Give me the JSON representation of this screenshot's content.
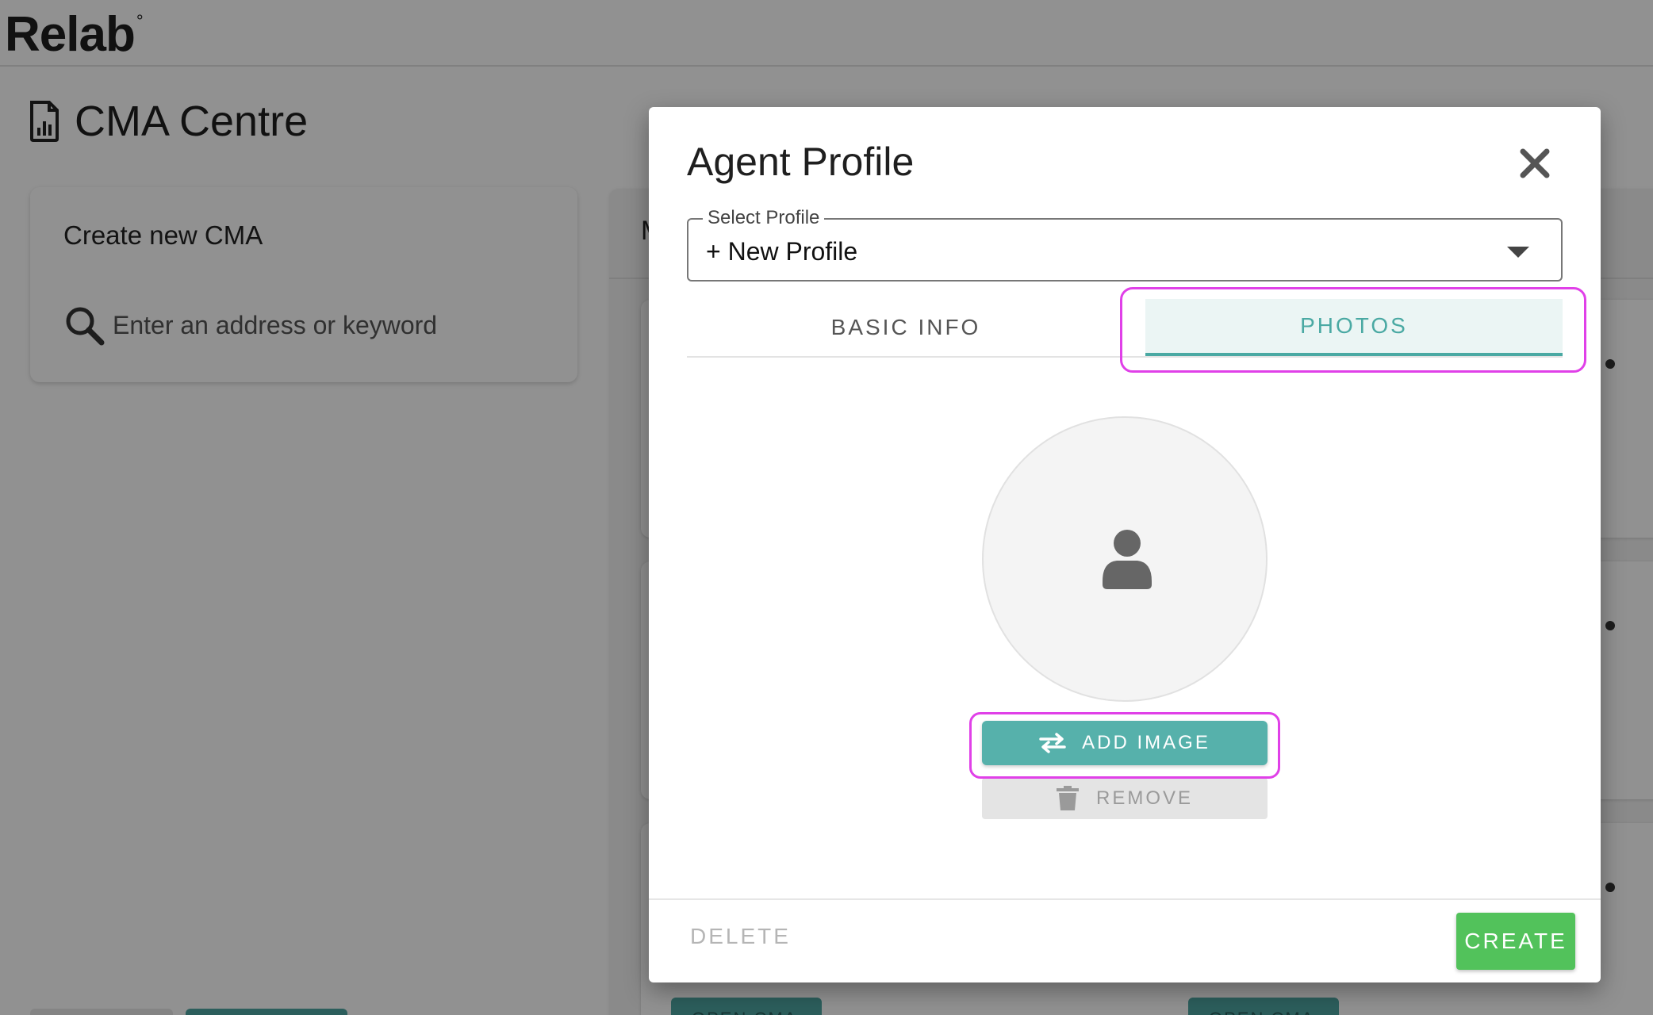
{
  "app": {
    "logo": "Relab",
    "logo_mark": "°",
    "page_title": "CMA Centre"
  },
  "create_card": {
    "heading": "Create new CMA",
    "search_placeholder": "Enter an address or keyword"
  },
  "right_panel": {
    "tab_stub": "M",
    "open_button_label": "OPEN CMA"
  },
  "modal": {
    "title": "Agent Profile",
    "select": {
      "label": "Select Profile",
      "value": "+ New Profile"
    },
    "tabs": [
      {
        "label": "BASIC INFO",
        "active": false
      },
      {
        "label": "PHOTOS",
        "active": true
      }
    ],
    "add_image_label": "ADD IMAGE",
    "remove_label": "REMOVE",
    "delete_label": "DELETE",
    "create_label": "CREATE"
  },
  "colors": {
    "accent": "#56b1ab",
    "create": "#52c25b",
    "highlight": "#e040e8"
  },
  "icons": {
    "doc": "document-chart-icon",
    "search": "search-icon",
    "close": "close-icon",
    "caret": "chevron-down-icon",
    "avatar": "person-icon",
    "swap": "swap-arrows-icon",
    "trash": "trash-icon"
  }
}
